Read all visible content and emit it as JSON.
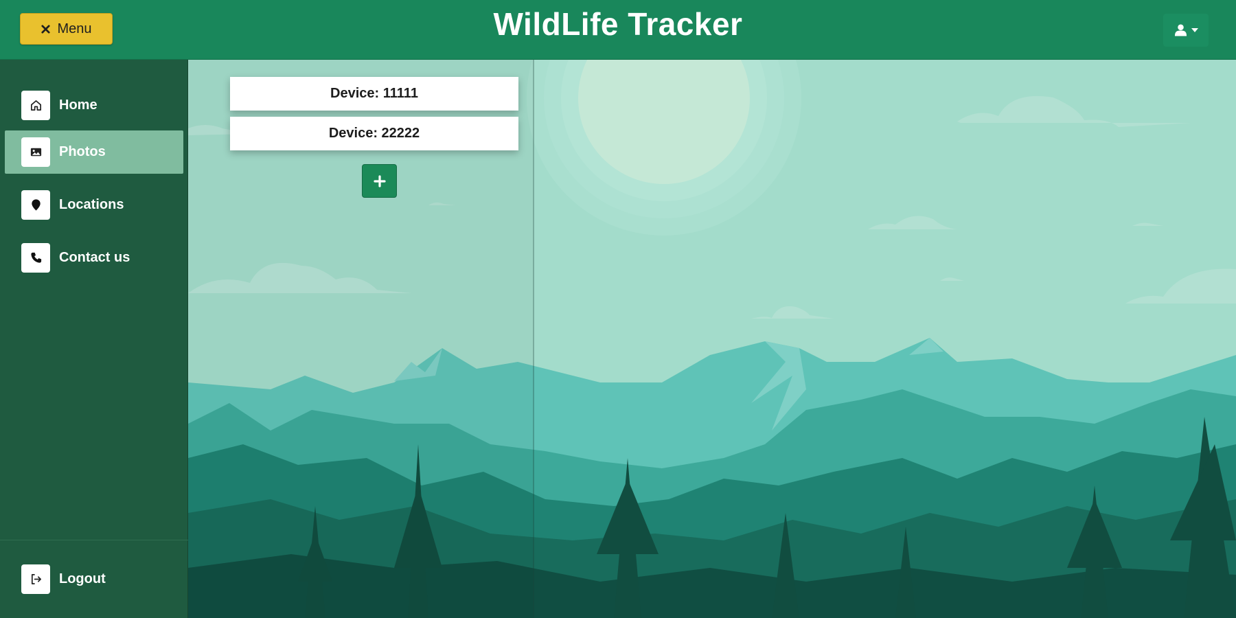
{
  "header": {
    "menu_label": "Menu",
    "title": "WildLife Tracker",
    "user_icon": "user-icon"
  },
  "sidebar": {
    "items": [
      {
        "label": "Home",
        "icon": "home-icon",
        "active": false
      },
      {
        "label": "Photos",
        "icon": "image-icon",
        "active": true
      },
      {
        "label": "Locations",
        "icon": "map-marker-icon",
        "active": false
      },
      {
        "label": "Contact us",
        "icon": "phone-icon",
        "active": false
      }
    ],
    "logout_label": "Logout"
  },
  "devices": [
    {
      "label": "Device: 11111"
    },
    {
      "label": "Device: 22222"
    }
  ],
  "add_button_icon": "plus-icon",
  "colors": {
    "header": "#19875b",
    "sidebar": "#1f5b40",
    "sidebar_active": "#80bc9f",
    "menu_button": "#e9c12e",
    "add_button": "#1b8a58",
    "sky": "#a3dccb"
  }
}
